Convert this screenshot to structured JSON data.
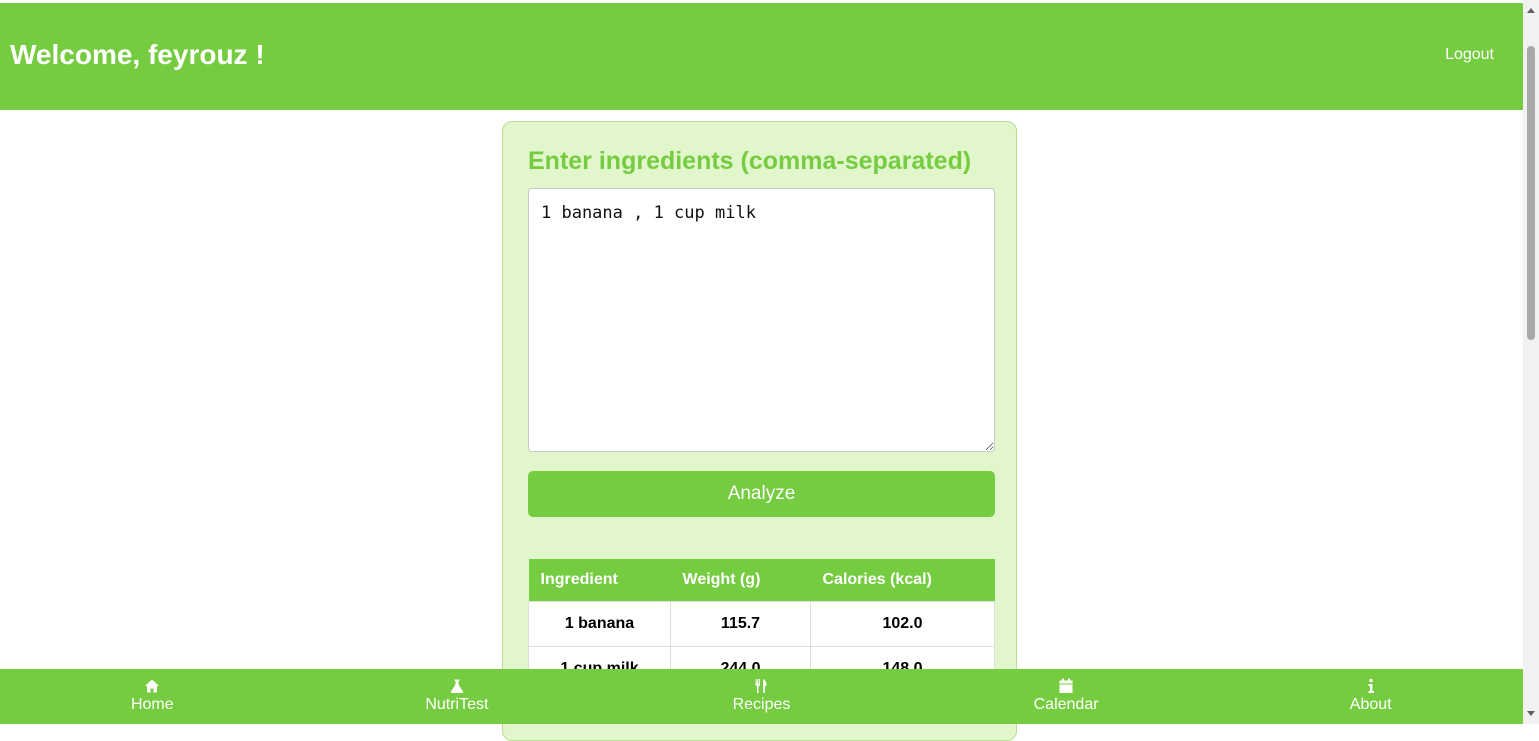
{
  "header": {
    "title": "Welcome, feyrouz !",
    "logout_label": "Logout"
  },
  "form": {
    "heading": "Enter ingredients (comma-separated)",
    "ingredients_value": "1 banana , 1 cup milk",
    "analyze_label": "Analyze"
  },
  "results": {
    "columns": [
      "Ingredient",
      "Weight (g)",
      "Calories (kcal)"
    ],
    "rows": [
      {
        "ingredient": "1 banana",
        "weight": "115.7",
        "calories": "102.0"
      },
      {
        "ingredient": "1 cup milk",
        "weight": "244.0",
        "calories": "148.0"
      }
    ]
  },
  "nav": {
    "items": [
      {
        "label": "Home",
        "icon": "home-icon"
      },
      {
        "label": "NutriTest",
        "icon": "flask-icon"
      },
      {
        "label": "Recipes",
        "icon": "utensils-icon"
      },
      {
        "label": "Calendar",
        "icon": "calendar-icon"
      },
      {
        "label": "About",
        "icon": "info-icon"
      }
    ]
  },
  "colors": {
    "accent": "#76cc41",
    "card_background": "#e1f6cb"
  }
}
